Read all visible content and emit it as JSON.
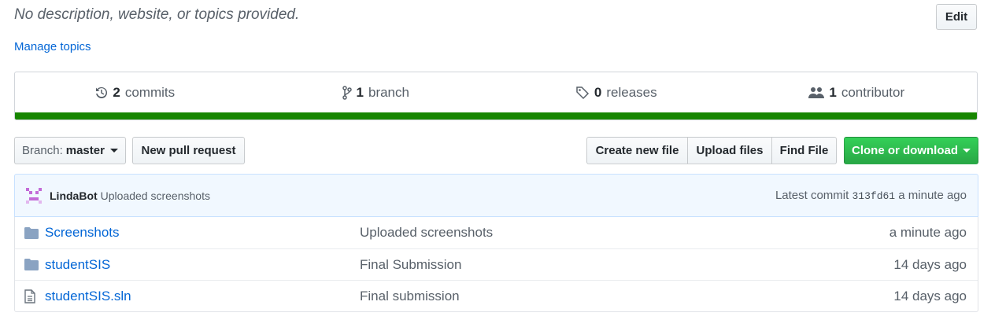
{
  "repo": {
    "description": "No description, website, or topics provided.",
    "edit_label": "Edit",
    "manage_topics": "Manage topics"
  },
  "summary": {
    "commits_count": "2",
    "commits_label": "commits",
    "branch_count": "1",
    "branch_label": "branch",
    "releases_count": "0",
    "releases_label": "releases",
    "contributors_count": "1",
    "contributors_label": "contributor",
    "language_color": "#178600"
  },
  "toolbar": {
    "branch_prefix": "Branch:",
    "branch_name": "master",
    "new_pr": "New pull request",
    "create_file": "Create new file",
    "upload_files": "Upload files",
    "find_file": "Find File",
    "clone": "Clone or download"
  },
  "commit": {
    "author": "LindaBot",
    "message": "Uploaded screenshots",
    "latest_label": "Latest commit",
    "sha": "313fd61",
    "age": "a minute ago"
  },
  "files": [
    {
      "type": "folder",
      "name": "Screenshots",
      "message": "Uploaded screenshots",
      "age": "a minute ago"
    },
    {
      "type": "folder",
      "name": "studentSIS",
      "message": "Final Submission",
      "age": "14 days ago"
    },
    {
      "type": "file",
      "name": "studentSIS.sln",
      "message": "Final submission",
      "age": "14 days ago"
    }
  ]
}
